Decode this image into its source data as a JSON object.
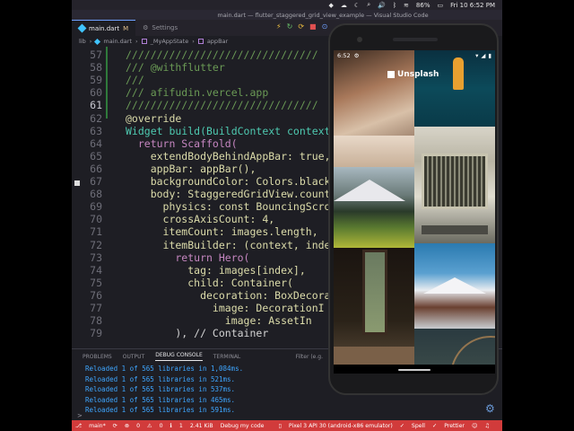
{
  "menubar": {
    "percent": "86%",
    "datetime": "Fri 10  6:52 PM"
  },
  "window_title": "main.dart — flutter_staggered_grid_view_example — Visual Studio Code",
  "tabs": [
    {
      "label": "main.dart",
      "modifier": "M"
    },
    {
      "label": "Settings"
    }
  ],
  "breadcrumb": [
    "lib",
    "main.dart",
    "_MyAppState",
    "appBar"
  ],
  "editor": {
    "lines": [
      {
        "n": "57",
        "code": "///////////////////////////////"
      },
      {
        "n": "58",
        "code": "/// @withflutter"
      },
      {
        "n": "59",
        "code": "///"
      },
      {
        "n": "60",
        "code": "/// afifudin.vercel.app"
      },
      {
        "n": "61",
        "code": "///////////////////////////////"
      },
      {
        "n": "62",
        "code": "@override"
      },
      {
        "n": "63",
        "code": "Widget build(BuildContext context"
      },
      {
        "n": "64",
        "code": "  return Scaffold("
      },
      {
        "n": "65",
        "code": "    extendBodyBehindAppBar: true,"
      },
      {
        "n": "66",
        "code": "    appBar: appBar(),"
      },
      {
        "n": "67",
        "code": "    backgroundColor: Colors.black"
      },
      {
        "n": "68",
        "code": "    body: StaggeredGridView.countB"
      },
      {
        "n": "69",
        "code": "      physics: const BouncingScro"
      },
      {
        "n": "70",
        "code": "      crossAxisCount: 4,"
      },
      {
        "n": "71",
        "code": "      itemCount: images.length,"
      },
      {
        "n": "72",
        "code": "      itemBuilder: (context, inde"
      },
      {
        "n": "73",
        "code": "        return Hero("
      },
      {
        "n": "74",
        "code": "          tag: images[index],"
      },
      {
        "n": "75",
        "code": "          child: Container("
      },
      {
        "n": "76",
        "code": "            decoration: BoxDecorat"
      },
      {
        "n": "77",
        "code": "              image: DecorationI"
      },
      {
        "n": "78",
        "code": "                image: AssetIn"
      },
      {
        "n": "79",
        "code": "        ), // Container"
      }
    ]
  },
  "panel": {
    "tabs": [
      "PROBLEMS",
      "OUTPUT",
      "DEBUG CONSOLE",
      "TERMINAL"
    ],
    "active_tab": "DEBUG CONSOLE",
    "filter_placeholder": "Filter (e.g.",
    "console": [
      "Reloaded 1 of 565 libraries in 1,084ms.",
      "Reloaded 1 of 565 libraries in 521ms.",
      "Reloaded 1 of 565 libraries in 537ms.",
      "Reloaded 1 of 565 libraries in 465ms.",
      "Reloaded 1 of 565 libraries in 591ms."
    ],
    "prompt": ">"
  },
  "statusbar": {
    "branch": "main*",
    "sync": "⟳",
    "errors": "0",
    "warnings": "0",
    "info": "1",
    "size": "2.41 KiB",
    "debug": "Debug my code",
    "device": "Pixel 3 API 30 (android-x86 emulator)",
    "spell": "Spell",
    "prettier": "Prettier"
  },
  "phone": {
    "time": "6:52",
    "app_title": "Unsplash"
  },
  "colors": {
    "keyword": "#c586c0",
    "type": "#4ec9b0",
    "property": "#dcdcaa",
    "comment": "#6a9955",
    "default": "#d4d4d4",
    "status_red": "#d13b3b"
  }
}
